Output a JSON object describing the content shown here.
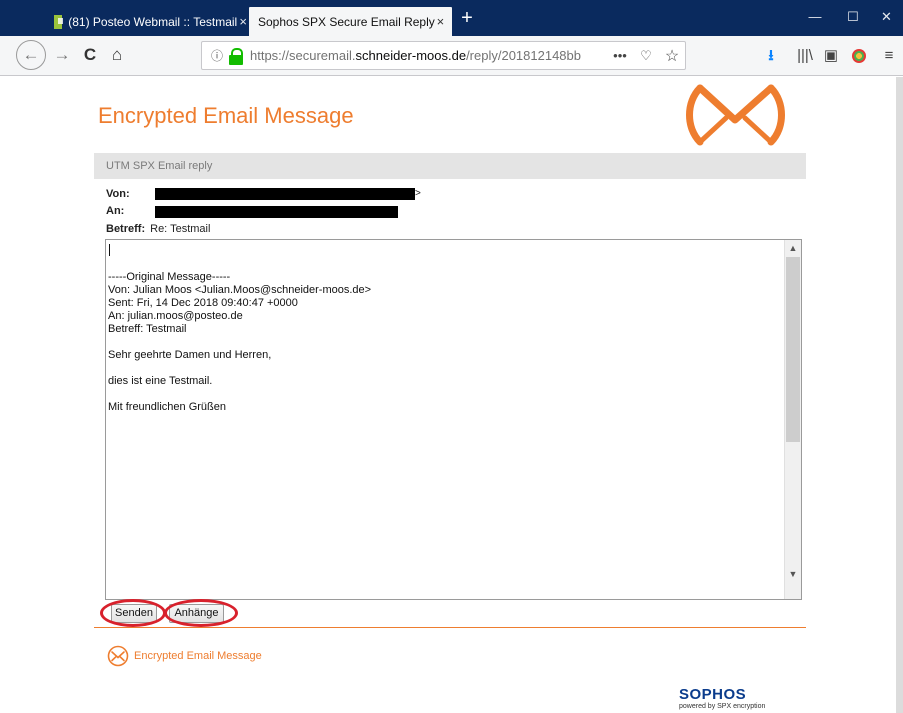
{
  "browser": {
    "tabs": [
      {
        "label": "(81) Posteo Webmail :: Testmail",
        "close": "×"
      },
      {
        "label": "Sophos SPX Secure Email Reply",
        "close": "×"
      }
    ],
    "new_tab": "+",
    "window": {
      "minimize": "—",
      "maximize": "☐",
      "close": "✕"
    },
    "nav": {
      "back": "←",
      "forward": "→",
      "reload": "C",
      "home": "⌂"
    },
    "url": {
      "info": "ⓘ",
      "prefix": "https://securemail.",
      "domain": "schneider-moos.de",
      "path": "/reply/201812148bb",
      "more": "•••",
      "pocket": "♡",
      "star": "☆"
    },
    "toolbar": {
      "download": "⭳",
      "library": "|||\\",
      "sidebar": "▣",
      "menu": "≡"
    }
  },
  "page": {
    "heading": "Encrypted Email Message",
    "section_title": "UTM SPX Email reply",
    "fields": {
      "from_label": "Von:",
      "from_suffix": ">",
      "to_label": "An:",
      "subject_label": "Betreff:",
      "subject_value": "Re: Testmail"
    },
    "body_text": "\n\n-----Original Message-----\nVon: Julian Moos <Julian.Moos@schneider-moos.de>\nSent: Fri, 14 Dec 2018 09:40:47 +0000\nAn: julian.moos@posteo.de\nBetreff: Testmail\n\nSehr geehrte Damen und Herren,\n\ndies ist eine Testmail.\n\nMit freundlichen Grüßen",
    "buttons": {
      "send": "Senden",
      "attachments": "Anhänge"
    },
    "footer_text": "Encrypted Email Message",
    "brand": "SOPHOS",
    "brand_sub": "powered by SPX encryption",
    "accent_color": "#ee7d2f",
    "highlight_color": "#d8212c"
  }
}
